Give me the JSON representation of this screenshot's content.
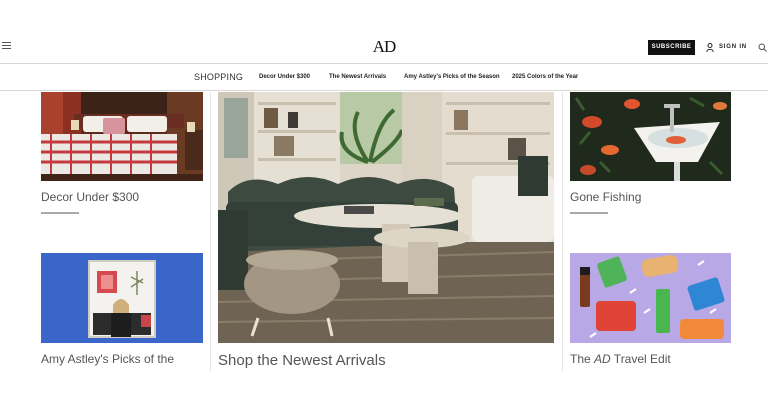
{
  "header": {
    "logo": "AD",
    "subscribe_label": "SUBSCRIBE",
    "signin_label": "SIGN IN",
    "icons": {
      "menu": "menu-icon",
      "user": "user-icon",
      "search": "search-icon"
    }
  },
  "subnav": {
    "section": "SHOPPING",
    "links": [
      "Decor Under $300",
      "The Newest Arrivals",
      "Amy Astley's Picks of the Season",
      "2025 Colors of the Year"
    ]
  },
  "cards": {
    "decor": {
      "caption": "Decor Under $300"
    },
    "fishing": {
      "caption": "Gone Fishing"
    },
    "astley": {
      "caption": "Amy Astley's Picks of the"
    },
    "arrivals": {
      "caption": "Shop the Newest Arrivals"
    },
    "travel": {
      "caption_prefix": "The ",
      "caption_em": "AD",
      "caption_suffix": " Travel Edit"
    }
  }
}
